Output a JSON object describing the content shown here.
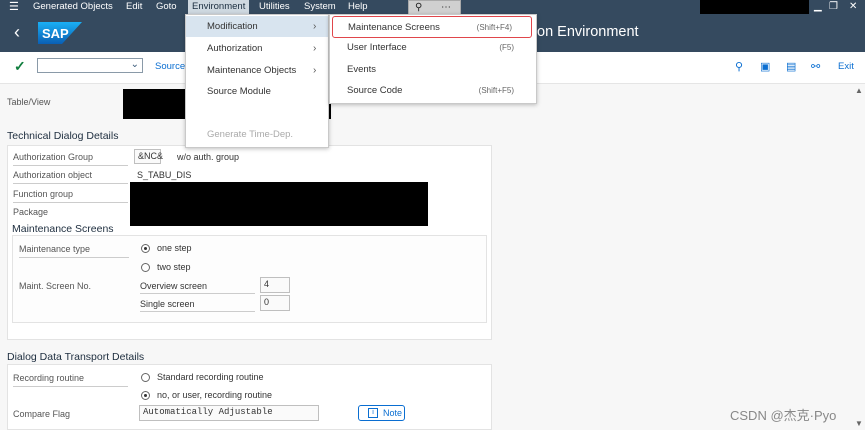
{
  "menubar": {
    "items": [
      "Generated Objects",
      "Edit",
      "Goto",
      "Environment",
      "Utilities",
      "System",
      "Help"
    ]
  },
  "header": {
    "back": "‹",
    "logo": "SAP",
    "title": "on Environment"
  },
  "toolbar": {
    "source_label": "Source",
    "exit_label": "Exit"
  },
  "tableview_label": "Table/View",
  "technical": {
    "title": "Technical Dialog Details",
    "auth_group_label": "Authorization Group",
    "auth_group_value": "&NC&",
    "auth_group_desc": "w/o auth. group",
    "auth_object_label": "Authorization object",
    "auth_object_value": "S_TABU_DIS",
    "function_group_label": "Function group",
    "package_label": "Package"
  },
  "maint": {
    "title": "Maintenance Screens",
    "type_label": "Maintenance type",
    "opt_one": "one step",
    "opt_two": "two step",
    "screen_no_label": "Maint. Screen No.",
    "overview_label": "Overview screen",
    "overview_value": "4",
    "single_label": "Single screen",
    "single_value": "0"
  },
  "transport": {
    "title": "Dialog Data Transport Details",
    "recording_label": "Recording routine",
    "opt_standard": "Standard recording routine",
    "opt_user": "no, or user, recording routine",
    "compare_label": "Compare Flag",
    "compare_value": "Automatically Adjustable",
    "note_label": "Note"
  },
  "env_menu": {
    "modification": "Modification",
    "authorization": "Authorization",
    "maint_objects": "Maintenance Objects",
    "source_module": "Source Module",
    "gen_time_dep": "Generate Time-Dep."
  },
  "mod_menu": {
    "maint_screens": "Maintenance Screens",
    "maint_screens_sc": "(Shift+F4)",
    "user_interface": "User Interface",
    "user_interface_sc": "(F5)",
    "events": "Events",
    "source_code": "Source Code",
    "source_code_sc": "(Shift+F5)"
  },
  "watermark": "CSDN @杰克·Pyo",
  "colors": {
    "shell": "#354a5f",
    "accent": "#0a6ed1",
    "highlight": "#e0464b",
    "ok": "#107e3e"
  }
}
